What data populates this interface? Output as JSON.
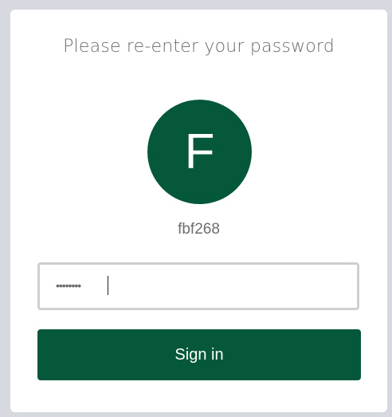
{
  "dialog": {
    "title": "Please re-enter your password"
  },
  "account": {
    "avatar_letter": "F",
    "username": "fbf268",
    "avatar_color": "#05593a"
  },
  "password": {
    "masked_value": "••••••••"
  },
  "actions": {
    "sign_in_label": "Sign in",
    "button_color": "#05593a"
  }
}
